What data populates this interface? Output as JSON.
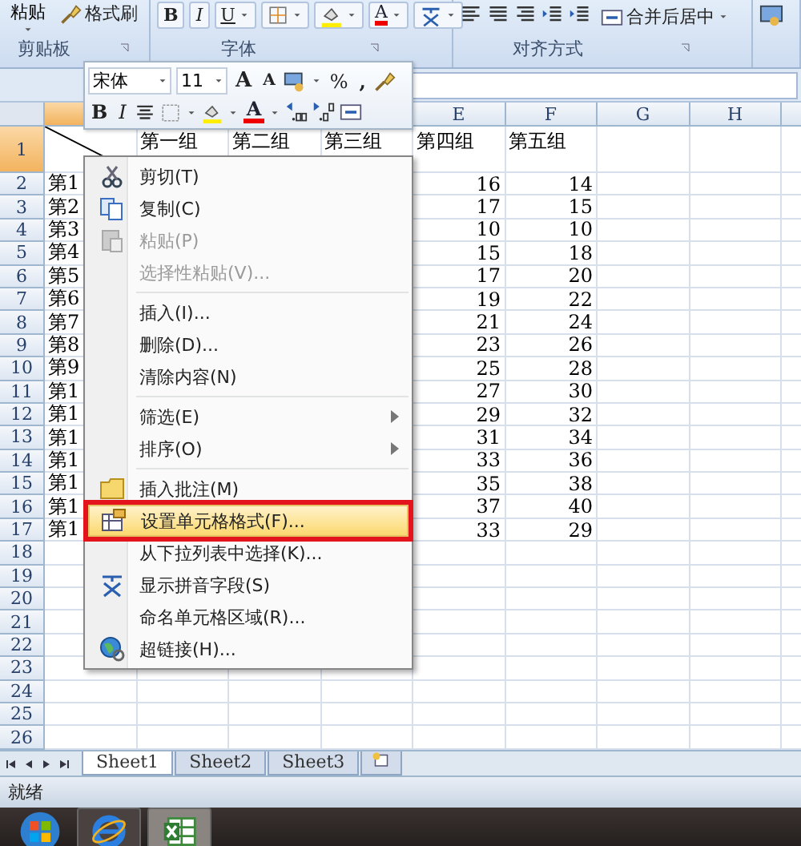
{
  "ribbon": {
    "clipboard": {
      "paste": "粘贴",
      "format_painter": "格式刷",
      "label": "剪贴板"
    },
    "font": {
      "bold": "B",
      "italic": "I",
      "underline": "U",
      "font_color": "A",
      "label": "字体"
    },
    "alignment": {
      "merge": "合并后居中",
      "label": "对齐方式"
    }
  },
  "mini_toolbar": {
    "font": "宋体",
    "size": "11",
    "grow_font": "A",
    "shrink_font": "A",
    "percent": "%",
    "comma": ",",
    "bold": "B",
    "italic": "I",
    "font_color": "A"
  },
  "sheet": {
    "column_a": {
      "selected": true
    },
    "columns": [
      {
        "label": "E",
        "selected": false
      },
      {
        "label": "F",
        "selected": false
      },
      {
        "label": "G",
        "selected": false
      },
      {
        "label": "H",
        "selected": false
      }
    ],
    "rows": [
      {
        "number": "1",
        "selected": true,
        "diagonal": true,
        "cells": {
          "B": "第一组",
          "C": "第二组",
          "D": "第三组",
          "E": "第四组",
          "F": "第五组"
        }
      },
      {
        "number": "2",
        "selected": false,
        "cells": {
          "A": "第1",
          "E": "16",
          "F": "14"
        }
      },
      {
        "number": "3",
        "selected": false,
        "cells": {
          "A": "第2",
          "E": "17",
          "F": "15"
        }
      },
      {
        "number": "4",
        "selected": false,
        "cells": {
          "A": "第3",
          "E": "10",
          "F": "10"
        }
      },
      {
        "number": "5",
        "selected": false,
        "cells": {
          "A": "第4",
          "E": "15",
          "F": "18"
        }
      },
      {
        "number": "6",
        "selected": false,
        "cells": {
          "A": "第5",
          "E": "17",
          "F": "20"
        }
      },
      {
        "number": "7",
        "selected": false,
        "cells": {
          "A": "第6",
          "E": "19",
          "F": "22"
        }
      },
      {
        "number": "8",
        "selected": false,
        "cells": {
          "A": "第7",
          "E": "21",
          "F": "24"
        }
      },
      {
        "number": "9",
        "selected": false,
        "cells": {
          "A": "第8",
          "E": "23",
          "F": "26"
        }
      },
      {
        "number": "10",
        "selected": false,
        "cells": {
          "A": "第9",
          "E": "25",
          "F": "28"
        }
      },
      {
        "number": "11",
        "selected": false,
        "cells": {
          "A": "第1",
          "E": "27",
          "F": "30"
        }
      },
      {
        "number": "12",
        "selected": false,
        "cells": {
          "A": "第1",
          "E": "29",
          "F": "32"
        }
      },
      {
        "number": "13",
        "selected": false,
        "cells": {
          "A": "第1",
          "E": "31",
          "F": "34"
        }
      },
      {
        "number": "14",
        "selected": false,
        "cells": {
          "A": "第1",
          "E": "33",
          "F": "36"
        }
      },
      {
        "number": "15",
        "selected": false,
        "cells": {
          "A": "第1",
          "E": "35",
          "F": "38"
        }
      },
      {
        "number": "16",
        "selected": false,
        "cells": {
          "A": "第1",
          "E": "37",
          "F": "40"
        }
      },
      {
        "number": "17",
        "selected": false,
        "cells": {
          "A": "第1",
          "E": "33",
          "F": "29"
        }
      },
      {
        "number": "18",
        "selected": false
      },
      {
        "number": "19",
        "selected": false
      },
      {
        "number": "20",
        "selected": false
      },
      {
        "number": "21",
        "selected": false
      },
      {
        "number": "22",
        "selected": false
      },
      {
        "number": "23",
        "selected": false
      },
      {
        "number": "24",
        "selected": false
      },
      {
        "number": "25",
        "selected": false
      },
      {
        "number": "26",
        "selected": false
      }
    ]
  },
  "context_menu": [
    {
      "kind": "item",
      "label": "剪切(T)",
      "disabled": false,
      "submenu": false,
      "selected": false
    },
    {
      "kind": "item",
      "label": "复制(C)",
      "disabled": false,
      "submenu": false,
      "selected": false
    },
    {
      "kind": "item",
      "label": "粘贴(P)",
      "disabled": true,
      "submenu": false,
      "selected": false
    },
    {
      "kind": "item",
      "label": "选择性粘贴(V)...",
      "disabled": true,
      "submenu": false,
      "selected": false
    },
    {
      "kind": "separator"
    },
    {
      "kind": "item",
      "label": "插入(I)...",
      "disabled": false,
      "submenu": false,
      "selected": false
    },
    {
      "kind": "item",
      "label": "删除(D)...",
      "disabled": false,
      "submenu": false,
      "selected": false
    },
    {
      "kind": "item",
      "label": "清除内容(N)",
      "disabled": false,
      "submenu": false,
      "selected": false
    },
    {
      "kind": "separator"
    },
    {
      "kind": "item",
      "label": "筛选(E)",
      "disabled": false,
      "submenu": true,
      "selected": false
    },
    {
      "kind": "item",
      "label": "排序(O)",
      "disabled": false,
      "submenu": true,
      "selected": false
    },
    {
      "kind": "separator"
    },
    {
      "kind": "item",
      "label": "插入批注(M)",
      "disabled": false,
      "submenu": false,
      "selected": false
    },
    {
      "kind": "item",
      "label": "设置单元格格式(F)...",
      "disabled": false,
      "submenu": false,
      "selected": true
    },
    {
      "kind": "item",
      "label": "从下拉列表中选择(K)...",
      "disabled": false,
      "submenu": false,
      "selected": false
    },
    {
      "kind": "item",
      "label": "显示拼音字段(S)",
      "disabled": false,
      "submenu": false,
      "selected": false
    },
    {
      "kind": "item",
      "label": "命名单元格区域(R)...",
      "disabled": false,
      "submenu": false,
      "selected": false
    },
    {
      "kind": "item",
      "label": "超链接(H)...",
      "disabled": false,
      "submenu": false,
      "selected": false
    }
  ],
  "sheet_tabs": [
    {
      "label": "Sheet1",
      "selected": true
    },
    {
      "label": "Sheet2",
      "selected": false
    },
    {
      "label": "Sheet3",
      "selected": false
    }
  ],
  "status_bar": {
    "text": "就绪"
  }
}
